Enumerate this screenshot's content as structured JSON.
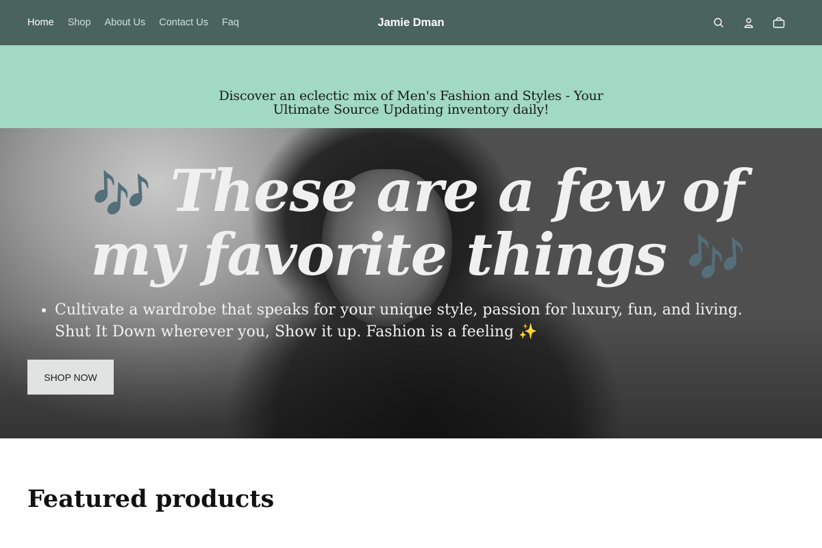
{
  "header": {
    "nav": [
      "Home",
      "Shop",
      "About Us",
      "Contact Us",
      "Faq"
    ],
    "brand": "Jamie Dman",
    "icons": [
      "search-icon",
      "account-icon",
      "cart-icon"
    ]
  },
  "announcement": {
    "line1": "Discover an eclectic mix of Men's Fashion and Styles - Your",
    "line2": "Ultimate Source Updating inventory daily!"
  },
  "hero": {
    "note_left": "🎶",
    "title_part1": "These are a few of",
    "title_part2": "my favorite things",
    "note_right": "🎶",
    "bullet": "Cultivate a wardrobe that speaks for your unique style, passion for luxury, fun, and living. Shut It Down wherever you, Show it up. Fashion is a feeling ✨",
    "button_label": "SHOP NOW"
  },
  "featured": {
    "title": "Featured products"
  },
  "colors": {
    "header_bg": "#4a635c",
    "announcement_bg": "#a2d9c5",
    "note_color": "#3f6f72"
  }
}
